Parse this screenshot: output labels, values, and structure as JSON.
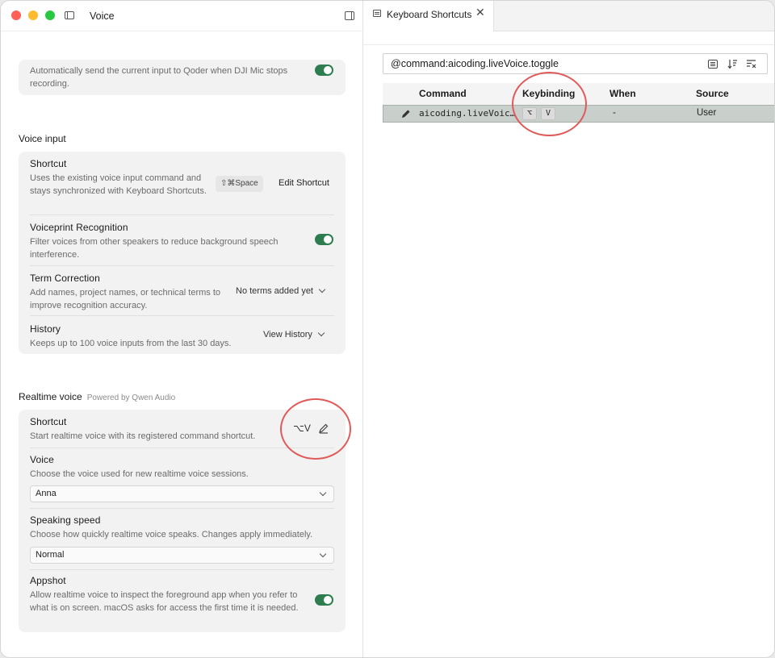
{
  "window": {
    "title": "Voice"
  },
  "top_card": {
    "desc": "Automatically send the current input to Qoder when DJI Mic stops recording.",
    "toggle_on": true
  },
  "voice_input": {
    "section_title": "Voice input",
    "shortcut": {
      "title": "Shortcut",
      "desc": "Uses the existing voice input command and stays synchronized with Keyboard Shortcuts.",
      "key": "⇧⌘Space",
      "edit_label": "Edit Shortcut"
    },
    "voiceprint": {
      "title": "Voiceprint Recognition",
      "desc": "Filter voices from other speakers to reduce background speech interference.",
      "toggle_on": true
    },
    "term_correction": {
      "title": "Term Correction",
      "desc": "Add names, project names, or technical terms to improve recognition accuracy.",
      "value": "No terms added yet"
    },
    "history": {
      "title": "History",
      "desc": "Keeps up to 100 voice inputs from the last 30 days.",
      "action": "View History"
    }
  },
  "realtime_voice": {
    "section_title": "Realtime voice",
    "powered_by": "Powered by Qwen Audio",
    "shortcut": {
      "title": "Shortcut",
      "desc": "Start realtime voice with its registered command shortcut.",
      "key": "⌥V"
    },
    "voice": {
      "title": "Voice",
      "desc": "Choose the voice used for new realtime voice sessions.",
      "selected": "Anna"
    },
    "speaking_speed": {
      "title": "Speaking speed",
      "desc": "Choose how quickly realtime voice speaks. Changes apply immediately.",
      "selected": "Normal"
    },
    "appshot": {
      "title": "Appshot",
      "desc": "Allow realtime voice to inspect the foreground app when you refer to what is on screen. macOS asks for access the first time it is needed.",
      "toggle_on": true
    }
  },
  "shortcuts_tab": {
    "label": "Keyboard Shortcuts",
    "close_glyph": "✕"
  },
  "search": {
    "value": "@command:aicoding.liveVoice.toggle"
  },
  "table": {
    "headers": [
      "Command",
      "Keybinding",
      "When",
      "Source"
    ],
    "rows": [
      {
        "command": "aicoding.liveVoic…",
        "keybinding": [
          "⌥",
          "V"
        ],
        "when": "-",
        "source": "User"
      }
    ]
  },
  "colors": {
    "annotation": "#e05a5a",
    "toggle_on": "#2e7d4f",
    "selected_row": "#c9cfca"
  }
}
